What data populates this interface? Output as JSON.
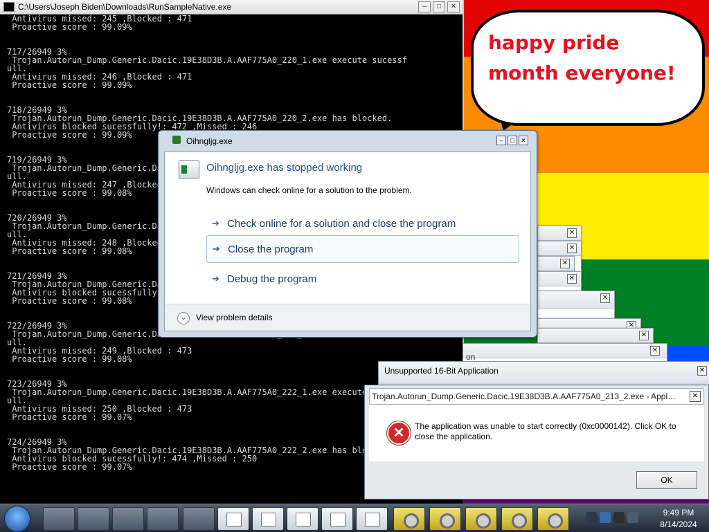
{
  "console": {
    "title": "C:\\Users\\Joseph Biden\\Downloads\\RunSampleNative.exe",
    "lines": [
      " Antivirus missed: 245 ,Blocked : 471",
      " Proactive score : 99.09%",
      "",
      "",
      "717/26949 3%",
      " Trojan.Autorun_Dump.Generic.Dacic.19E38D3B.A.AAF775A0_220_1.exe execute sucessf",
      "ull.",
      " Antivirus missed: 246 ,Blocked : 471",
      " Proactive score : 99.09%",
      "",
      "",
      "718/26949 3%",
      " Trojan.Autorun_Dump.Generic.Dacic.19E38D3B.A.AAF775A0_220_2.exe has blocked.",
      " Antivirus blocked sucessfully!: 472 ,Missed : 246",
      " Proactive score : 99.09%",
      "",
      "",
      "719/26949 3%",
      " Trojan.Autorun_Dump.Generic.Dacic.19E38D3B.A.AAF775A0_221_1.exe execute sucessf",
      "ull.",
      " Antivirus missed: 247 ,Blocked : 472",
      " Proactive score : 99.08%",
      "",
      "",
      "720/26949 3%",
      " Trojan.Autorun_Dump.Generic.Dacic.19E38D3B.A.AAF775A0_221_2.exe execute sucessf",
      "ull.",
      " Antivirus missed: 248 ,Blocked : 472",
      " Proactive score : 99.08%",
      "",
      "",
      "721/26949 3%",
      " Trojan.Autorun_Dump.Generic.Dacic.19E38D3B.A.AAF775A0_221_3.exe has blocked.",
      " Antivirus blocked sucessfully!: 473 ,Missed : 248",
      " Proactive score : 99.08%",
      "",
      "",
      "722/26949 3%",
      " Trojan.Autorun_Dump.Generic.Dacic.19E38D3B.A.AAF775A0_221_4.exe execute sucessf",
      "ull.",
      " Antivirus missed: 249 ,Blocked : 473",
      " Proactive score : 99.08%",
      "",
      "",
      "723/26949 3%",
      " Trojan.Autorun_Dump.Generic.Dacic.19E38D3B.A.AAF775A0_222_1.exe execute sucessf",
      "ull.",
      " Antivirus missed: 250 ,Blocked : 473",
      " Proactive score : 99.07%",
      "",
      "",
      "724/26949 3%",
      " Trojan.Autorun_Dump.Generic.Dacic.19E38D3B.A.AAF775A0_222_2.exe has blocked.",
      " Antivirus blocked sucessfully!: 474 ,Missed : 250",
      " Proactive score : 99.07%"
    ]
  },
  "wallpaper": {
    "bubble_text": "happy pride month everyone!",
    "flag_colors": [
      "#e40303",
      "#ff8c00",
      "#ffed00",
      "#008026",
      "#004dff",
      "#750787"
    ]
  },
  "wer_dialog": {
    "title": "Oihngljg.exe",
    "heading": "Oihngljg.exe has stopped working",
    "subtext": "Windows can check online for a solution to the problem.",
    "options": [
      "Check online for a solution and close the program",
      "Close the program",
      "Debug the program"
    ],
    "details": "View problem details"
  },
  "stacked_windows": {
    "partial_title": "on"
  },
  "unsupported16": {
    "title": "Unsupported 16-Bit Application"
  },
  "app_error": {
    "title": "Trojan.Autorun_Dump.Generic.Dacic.19E38D3B.A.AAF775A0_213_2.exe - Application ...",
    "message": "The application was unable to start correctly (0xc0000142). Click OK to close the application.",
    "ok": "OK"
  },
  "taskbar": {
    "time": "9:49 PM",
    "date": "8/14/2024"
  }
}
